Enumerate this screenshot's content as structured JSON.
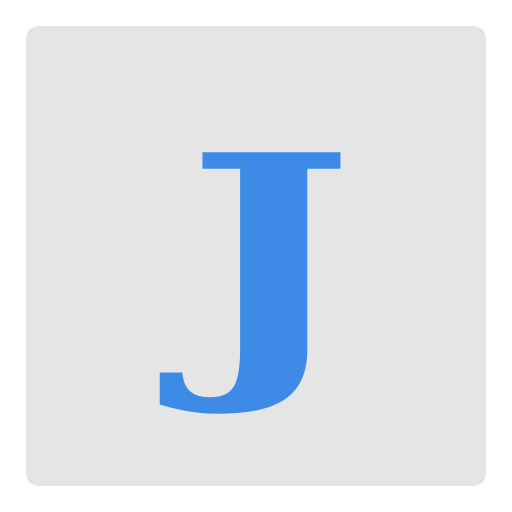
{
  "icon": {
    "letter": "J",
    "tile_color": "#e5e5e5",
    "letter_color": "#3d8be6"
  }
}
